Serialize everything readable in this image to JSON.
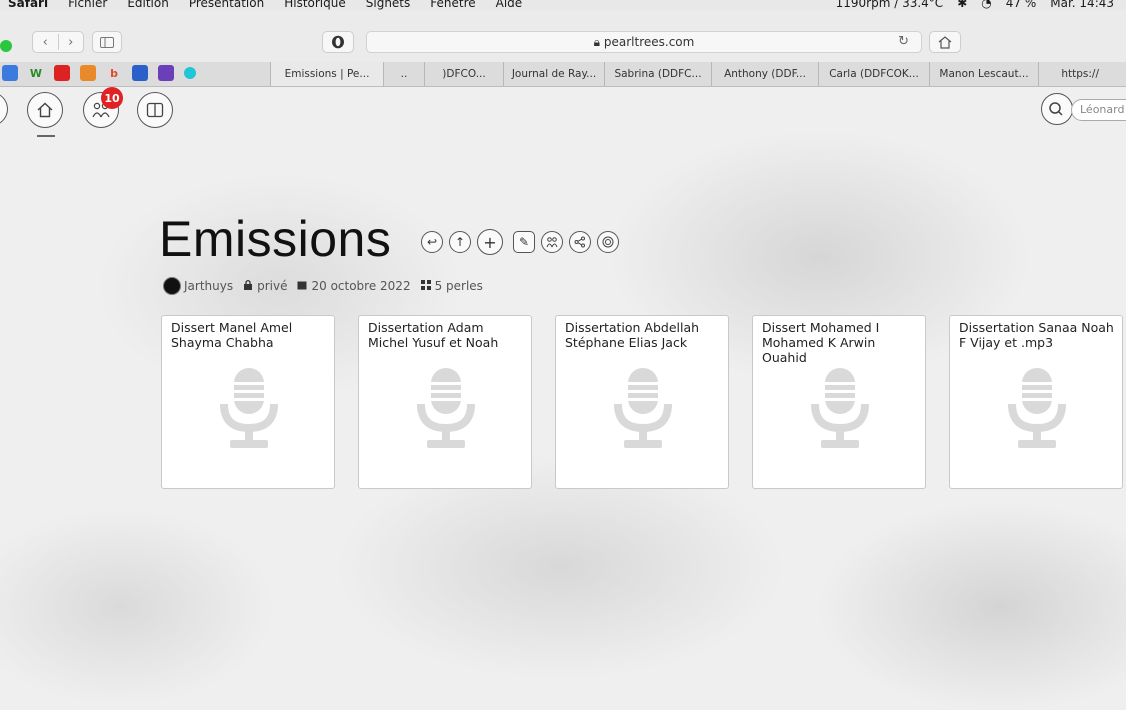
{
  "menubar": {
    "items": [
      "Safari",
      "Fichier",
      "Édition",
      "Présentation",
      "Historique",
      "Signets",
      "Fenêtre",
      "Aide"
    ],
    "status_text": "1190rpm / 33.4°C",
    "battery": "47 %",
    "clock": "Mar. 14:43"
  },
  "toolbar": {
    "url": "pearltrees.com",
    "opera_icon": "opera-icon"
  },
  "tabs": [
    "Emissions | Pe...",
    "..",
    ")DFCO...",
    "Journal de Ray...",
    "Sabrina (DDFC...",
    "Anthony (DDF...",
    "Carla (DDFCOK...",
    "Manon Lescaut...",
    "https://"
  ],
  "nav": {
    "notification_count": "10",
    "search_placeholder": "Léonard"
  },
  "collection": {
    "title": "Emissions",
    "author": "Jarthuys",
    "privacy": "privé",
    "date": "20 octobre 2022",
    "count": "5 perles"
  },
  "cards": [
    {
      "title": "Dissert Manel Amel Shayma Chabha"
    },
    {
      "title": "Dissertation Adam Michel Yusuf et Noah"
    },
    {
      "title": "Dissertation Abdellah Stéphane Elias Jack"
    },
    {
      "title": "Dissert Mohamed I Mohamed K Arwin Ouahid"
    },
    {
      "title": "Dissertation Sanaa Noah F Vijay et .mp3"
    }
  ],
  "colors": {
    "badge": "#e02222",
    "mic": "#d9d9d9",
    "traffic_green": "#2ac640"
  }
}
